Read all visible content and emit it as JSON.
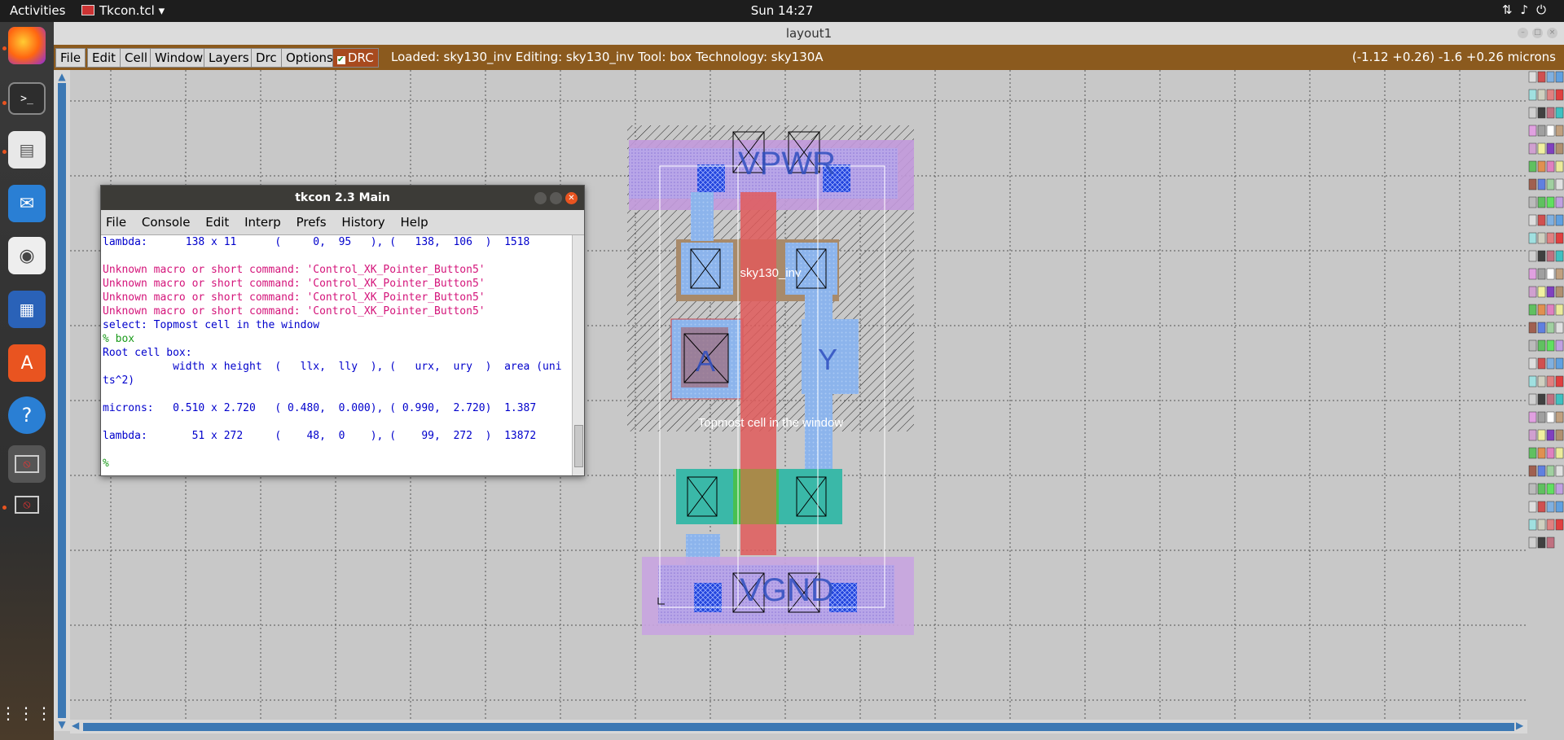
{
  "topbar": {
    "activities": "Activities",
    "app_name": "Tkcon.tcl",
    "clock": "Sun 14:27",
    "tray_icons": [
      "network-icon",
      "volume-icon",
      "power-icon"
    ]
  },
  "dock": {
    "apps": [
      "firefox-icon",
      "terminal-icon",
      "files-icon",
      "mail-icon",
      "rhythmbox-icon",
      "writer-icon",
      "software-icon",
      "help-icon",
      "unknown-app-icon",
      "unknown-app-icon"
    ]
  },
  "magic": {
    "title": "layout1",
    "menu": [
      "File",
      "Edit",
      "Cell",
      "Window",
      "Layers",
      "Drc",
      "Options"
    ],
    "drc_label": "DRC",
    "status": "Loaded: sky130_inv Editing: sky130_inv Tool: box  Technology: sky130A",
    "coords": "(-1.12 +0.26) -1.6 +0.26 microns"
  },
  "layout": {
    "cell_name": "sky130_inv",
    "labels": {
      "vpwr": "VPWR",
      "vgnd": "VGND",
      "a": "A",
      "y": "Y",
      "select_msg": "Topmost cell in the window"
    }
  },
  "tkcon": {
    "title": "tkcon 2.3 Main",
    "menu": [
      "File",
      "Console",
      "Edit",
      "Interp",
      "Prefs",
      "History",
      "Help"
    ],
    "lines": [
      {
        "t": "lambda:      138 x 11      (     0,  95   ), (   138,  106  )  1518",
        "c": "c-blue"
      },
      {
        "t": "",
        "c": ""
      },
      {
        "t": "Unknown macro or short command: 'Control_XK_Pointer_Button5'",
        "c": "c-mag"
      },
      {
        "t": "Unknown macro or short command: 'Control_XK_Pointer_Button5'",
        "c": "c-mag"
      },
      {
        "t": "Unknown macro or short command: 'Control_XK_Pointer_Button5'",
        "c": "c-mag"
      },
      {
        "t": "Unknown macro or short command: 'Control_XK_Pointer_Button5'",
        "c": "c-mag"
      },
      {
        "t": "select: Topmost cell in the window",
        "c": "c-blue"
      },
      {
        "t": "% box",
        "c": "c-grn"
      },
      {
        "t": "Root cell box:",
        "c": "c-blue"
      },
      {
        "t": "           width x height  (   llx,  lly  ), (   urx,  ury  )  area (uni",
        "c": "c-blue"
      },
      {
        "t": "ts^2)",
        "c": "c-blue"
      },
      {
        "t": "",
        "c": ""
      },
      {
        "t": "microns:   0.510 x 2.720   ( 0.480,  0.000), ( 0.990,  2.720)  1.387",
        "c": "c-blue"
      },
      {
        "t": "",
        "c": ""
      },
      {
        "t": "lambda:       51 x 272     (    48,  0    ), (    99,  272  )  13872",
        "c": "c-blue"
      },
      {
        "t": "",
        "c": ""
      },
      {
        "t": "%",
        "c": "c-grn"
      }
    ]
  }
}
